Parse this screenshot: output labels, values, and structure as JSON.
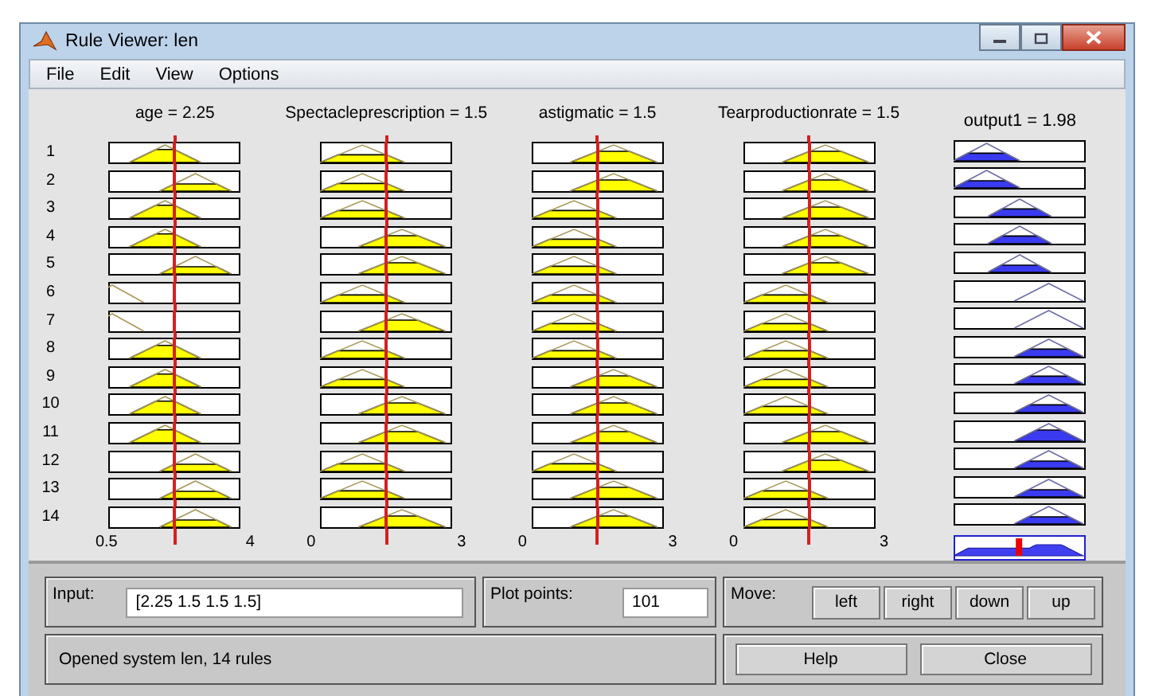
{
  "window": {
    "title": "Rule Viewer: len"
  },
  "menu": [
    {
      "label": "File"
    },
    {
      "label": "Edit"
    },
    {
      "label": "View"
    },
    {
      "label": "Options"
    }
  ],
  "inputs": [
    {
      "label": "age = 2.25",
      "level": 0.5,
      "range_min": "0.5",
      "range_max": "4"
    },
    {
      "label": "Spectacleprescription = 1.5",
      "level": 0.5,
      "range_min": "0",
      "range_max": "3"
    },
    {
      "label": "astigmatic = 1.5",
      "level": 0.5,
      "range_min": "0",
      "range_max": "3"
    },
    {
      "label": "Tearproductionrate = 1.5",
      "level": 0.5,
      "range_min": "0",
      "range_max": "3"
    }
  ],
  "output": {
    "label": "output1 = 1.98",
    "level": 0.495
  },
  "rules": [
    {
      "number": "1",
      "antecedents": [
        {
          "kind": "mid"
        },
        {
          "kind": "low"
        },
        {
          "kind": "high"
        },
        {
          "kind": "high"
        }
      ],
      "consequent": {
        "kind": "low"
      }
    },
    {
      "number": "2",
      "antecedents": [
        {
          "kind": "high"
        },
        {
          "kind": "low"
        },
        {
          "kind": "high"
        },
        {
          "kind": "high"
        }
      ],
      "consequent": {
        "kind": "low"
      }
    },
    {
      "number": "3",
      "antecedents": [
        {
          "kind": "mid"
        },
        {
          "kind": "low"
        },
        {
          "kind": "low"
        },
        {
          "kind": "high"
        }
      ],
      "consequent": {
        "kind": "mid"
      }
    },
    {
      "number": "4",
      "antecedents": [
        {
          "kind": "mid"
        },
        {
          "kind": "high"
        },
        {
          "kind": "low"
        },
        {
          "kind": "high"
        }
      ],
      "consequent": {
        "kind": "mid"
      }
    },
    {
      "number": "5",
      "antecedents": [
        {
          "kind": "high"
        },
        {
          "kind": "high"
        },
        {
          "kind": "low"
        },
        {
          "kind": "high"
        }
      ],
      "consequent": {
        "kind": "mid"
      }
    },
    {
      "number": "6",
      "antecedents": [
        {
          "kind": "low"
        },
        {
          "kind": "low"
        },
        {
          "kind": "low"
        },
        {
          "kind": "low"
        }
      ],
      "consequent": {
        "kind": "high"
      }
    },
    {
      "number": "7",
      "antecedents": [
        {
          "kind": "low"
        },
        {
          "kind": "high"
        },
        {
          "kind": "low"
        },
        {
          "kind": "low"
        }
      ],
      "consequent": {
        "kind": "high"
      }
    },
    {
      "number": "8",
      "antecedents": [
        {
          "kind": "mid"
        },
        {
          "kind": "low"
        },
        {
          "kind": "low"
        },
        {
          "kind": "low"
        }
      ],
      "consequent": {
        "kind": "high"
      }
    },
    {
      "number": "9",
      "antecedents": [
        {
          "kind": "mid"
        },
        {
          "kind": "low"
        },
        {
          "kind": "high"
        },
        {
          "kind": "low"
        }
      ],
      "consequent": {
        "kind": "high"
      }
    },
    {
      "number": "10",
      "antecedents": [
        {
          "kind": "mid"
        },
        {
          "kind": "high"
        },
        {
          "kind": "high"
        },
        {
          "kind": "low"
        }
      ],
      "consequent": {
        "kind": "high"
      }
    },
    {
      "number": "11",
      "antecedents": [
        {
          "kind": "mid"
        },
        {
          "kind": "high"
        },
        {
          "kind": "high"
        },
        {
          "kind": "high"
        }
      ],
      "consequent": {
        "kind": "high"
      }
    },
    {
      "number": "12",
      "antecedents": [
        {
          "kind": "high"
        },
        {
          "kind": "low"
        },
        {
          "kind": "low"
        },
        {
          "kind": "high"
        }
      ],
      "consequent": {
        "kind": "high"
      }
    },
    {
      "number": "13",
      "antecedents": [
        {
          "kind": "high"
        },
        {
          "kind": "low"
        },
        {
          "kind": "high"
        },
        {
          "kind": "low"
        }
      ],
      "consequent": {
        "kind": "high"
      }
    },
    {
      "number": "14",
      "antecedents": [
        {
          "kind": "high"
        },
        {
          "kind": "high"
        },
        {
          "kind": "high"
        },
        {
          "kind": "low"
        }
      ],
      "consequent": {
        "kind": "high"
      }
    }
  ],
  "input_field": {
    "label": "Input:",
    "value": "[2.25 1.5 1.5 1.5]"
  },
  "plot_points": {
    "label": "Plot points:",
    "value": "101"
  },
  "move": {
    "label": "Move:",
    "buttons": [
      "left",
      "right",
      "down",
      "up"
    ]
  },
  "status": "Opened system len, 14 rules",
  "buttons": [
    "Help",
    "Close"
  ]
}
